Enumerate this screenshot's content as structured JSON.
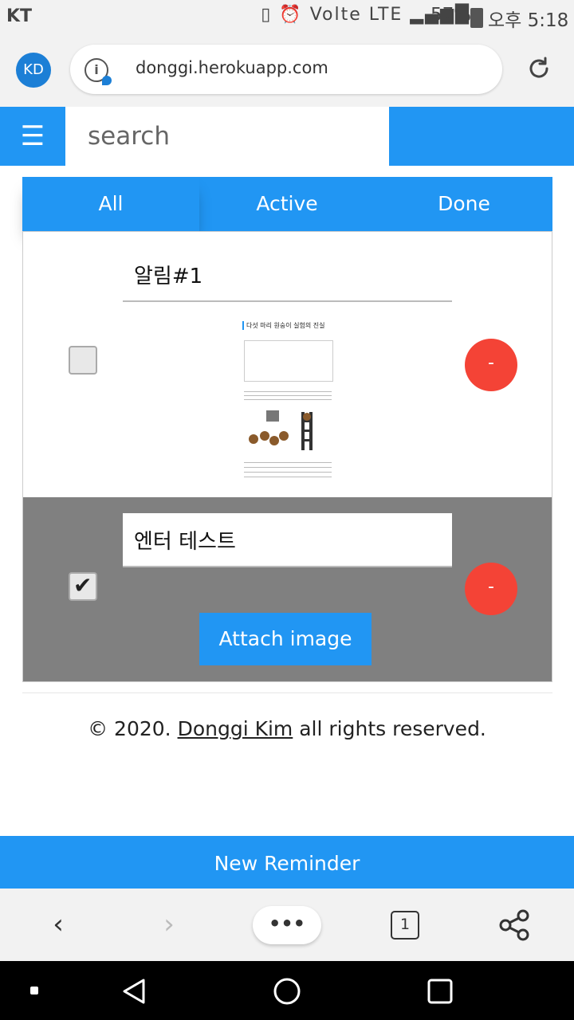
{
  "status_bar": {
    "carrier": "KT",
    "icons_text": "▯ ⏰ Volte LTE ▂▄▆█",
    "battery": "57%",
    "time": "오후 5:18"
  },
  "browser": {
    "avatar": "KD",
    "url": "donggi.herokuapp.com",
    "tab_count": "1"
  },
  "header": {
    "menu_icon": "☰",
    "search_placeholder": "search"
  },
  "tabs": [
    "All",
    "Active",
    "Done"
  ],
  "reminders": [
    {
      "title": "알림#1",
      "checked": false,
      "delete_label": "-",
      "image_title": "다섯 마리 원숭이 실험의 진실"
    },
    {
      "title": "엔터 테스트",
      "checked": true,
      "check_glyph": "✔",
      "delete_label": "-",
      "attach_label": "Attach image"
    }
  ],
  "footer": {
    "prefix": "© 2020. ",
    "author": "Donggi Kim",
    "suffix": " all rights reserved."
  },
  "new_reminder_label": "New Reminder",
  "toolbar": {
    "back": "‹",
    "forward": "›",
    "more": "•••",
    "share": "⋖"
  },
  "colors": {
    "primary": "#2196f3",
    "danger": "#f44336",
    "done_row": "#808080"
  }
}
